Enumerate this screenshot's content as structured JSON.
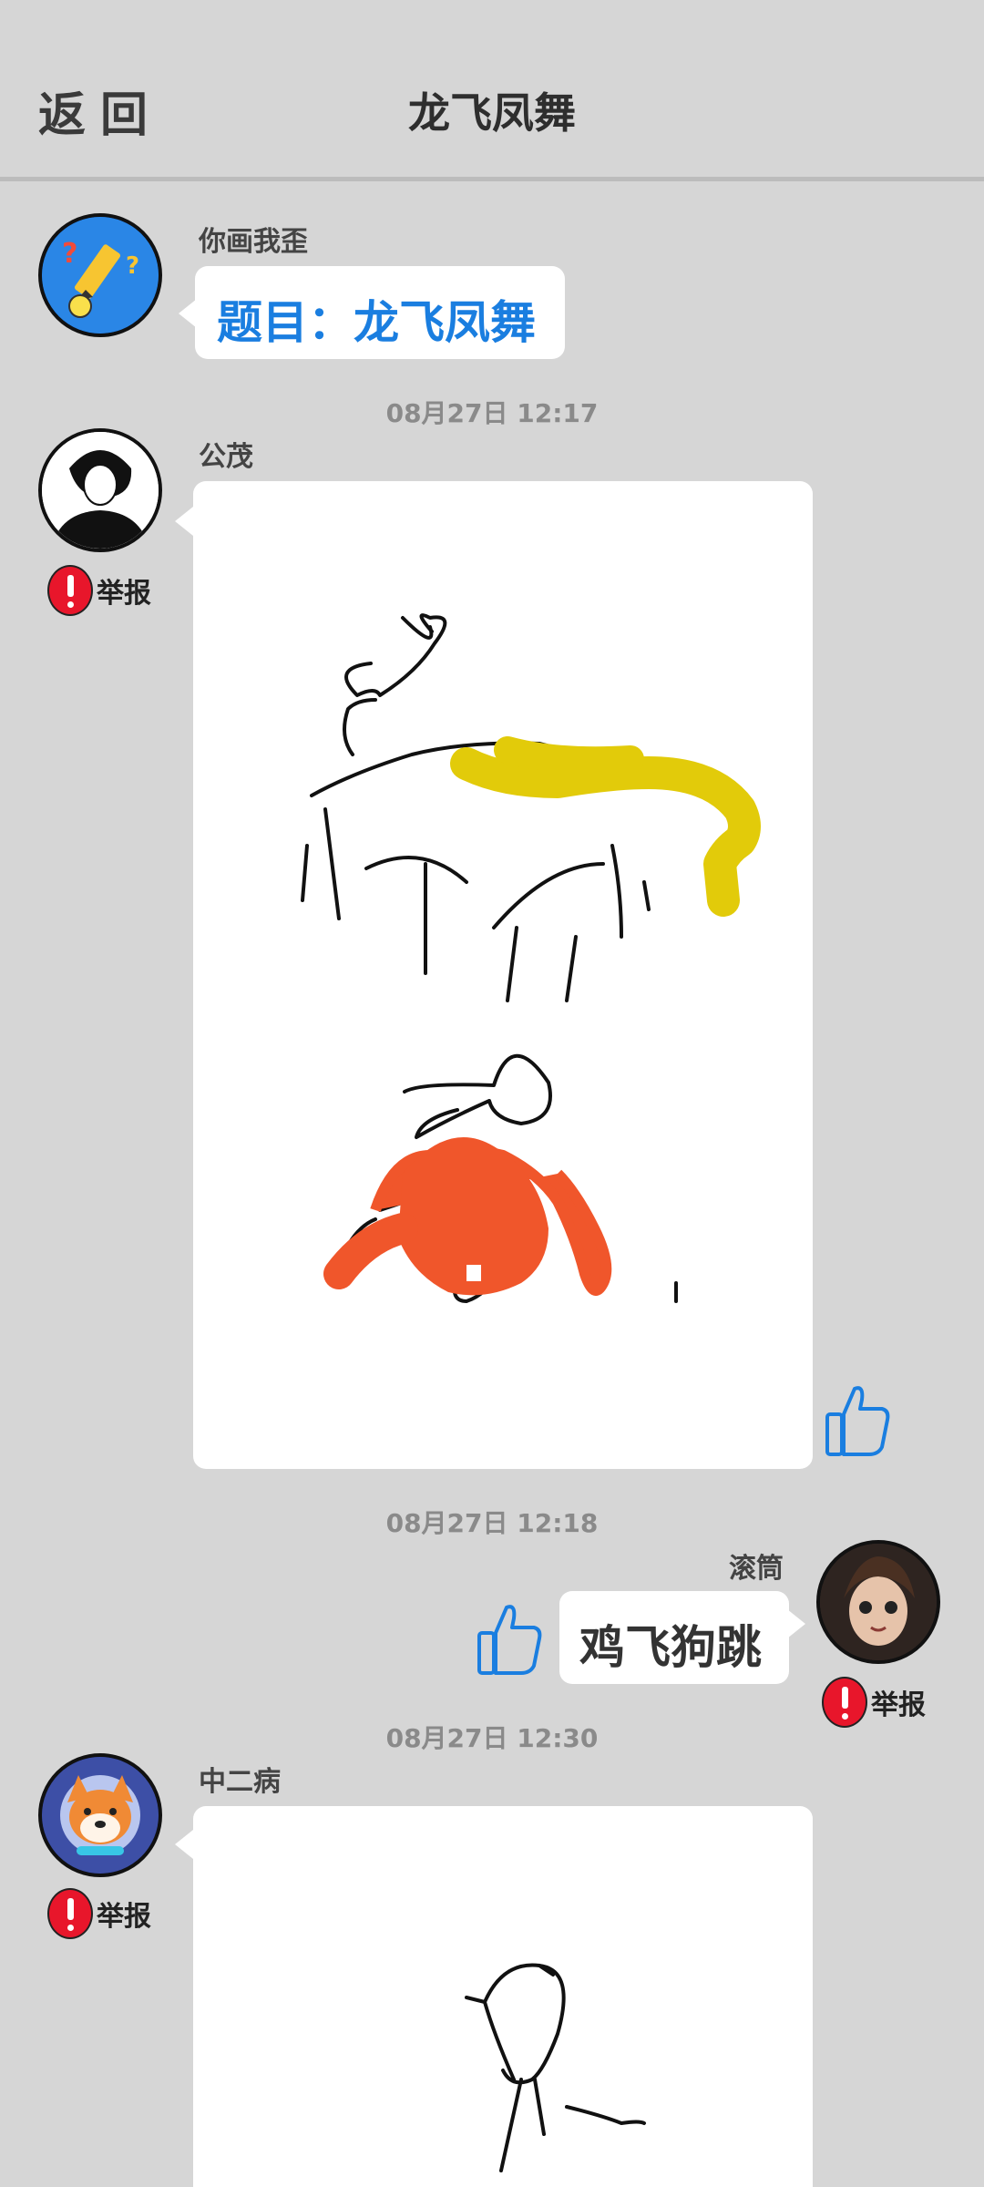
{
  "header": {
    "back_label": "返回",
    "title": "龙飞凤舞"
  },
  "messages": [
    {
      "sender": "你画我歪",
      "text": "题目：龙飞凤舞"
    },
    {
      "time": "08月27日  12:17",
      "sender": "公茂",
      "report_label": "举报"
    },
    {
      "time": "08月27日  12:18",
      "sender": "滚筒",
      "text": "鸡飞狗跳",
      "report_label": "举报"
    },
    {
      "time": "08月27日  12:30",
      "sender": "中二病",
      "report_label": "举报"
    }
  ],
  "colors": {
    "background": "#d6d6d6",
    "accent_blue": "#1a7ee0",
    "report_red": "#e8162b",
    "drawing_yellow": "#e2cb0a",
    "drawing_orange": "#f0562b"
  }
}
